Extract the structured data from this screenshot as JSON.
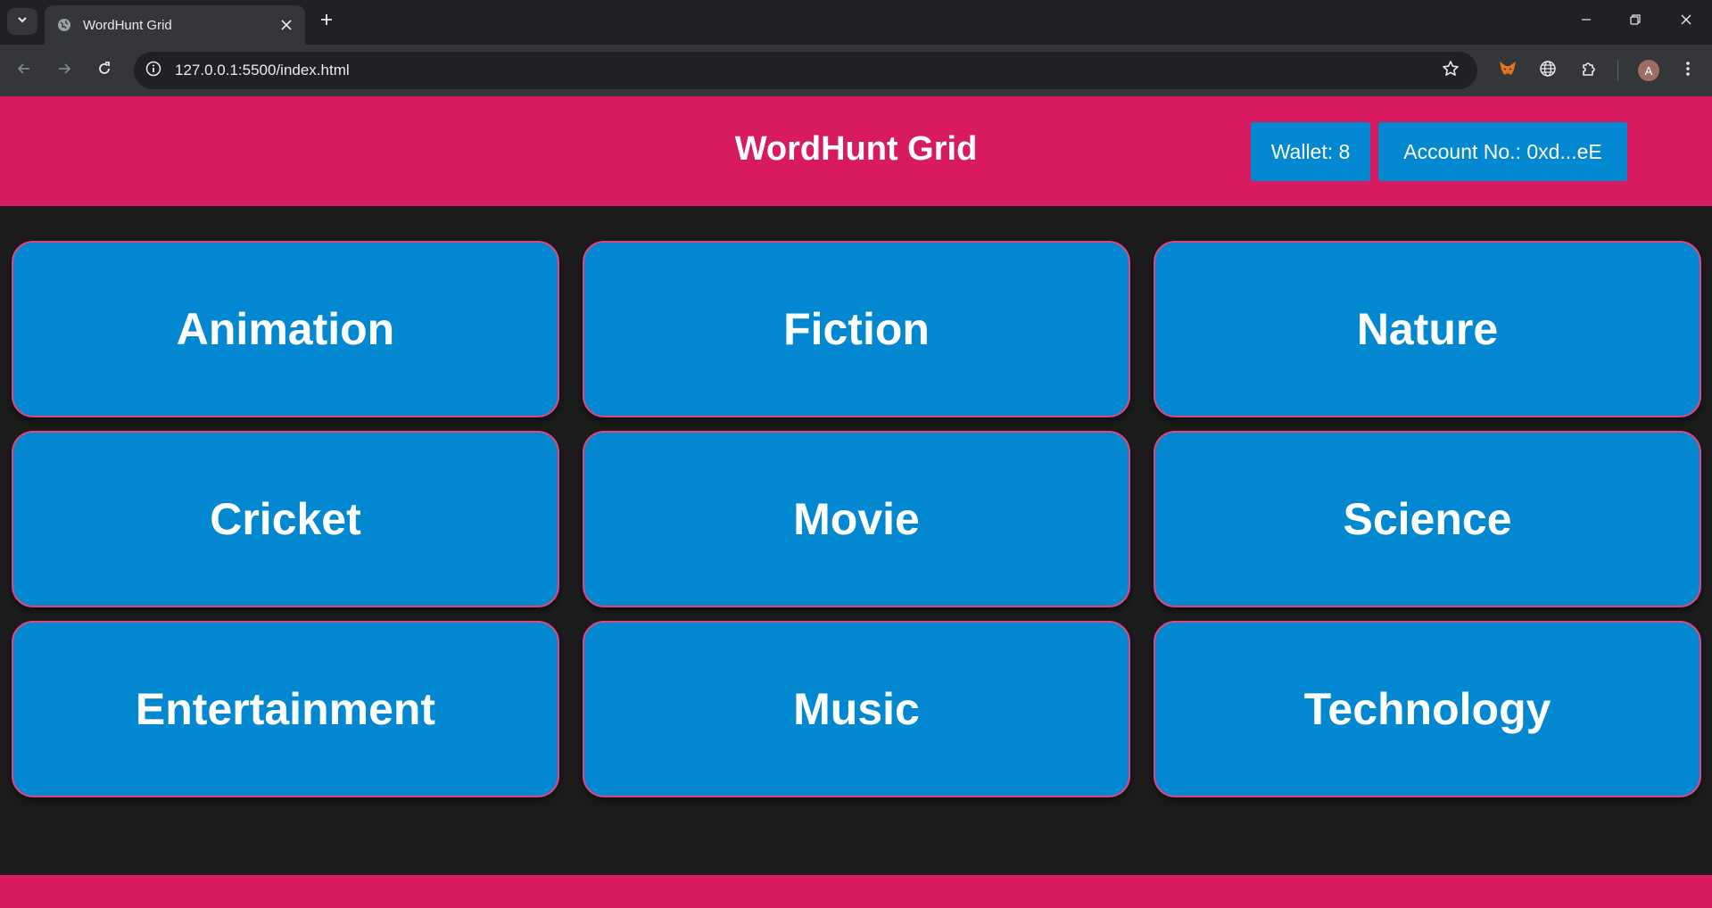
{
  "browser": {
    "tab_title": "WordHunt Grid",
    "url": "127.0.0.1:5500/index.html",
    "profile_initial": "A"
  },
  "header": {
    "title": "WordHunt Grid",
    "wallet_label": "Wallet: 8",
    "account_label": "Account No.: 0xd...eE"
  },
  "categories": [
    "Animation",
    "Fiction",
    "Nature",
    "Cricket",
    "Movie",
    "Science",
    "Entertainment",
    "Music",
    "Technology"
  ],
  "colors": {
    "header_bg": "#d81b60",
    "card_bg": "#0288d1",
    "card_border": "#e0457f",
    "page_bg": "#1c1c1c"
  }
}
